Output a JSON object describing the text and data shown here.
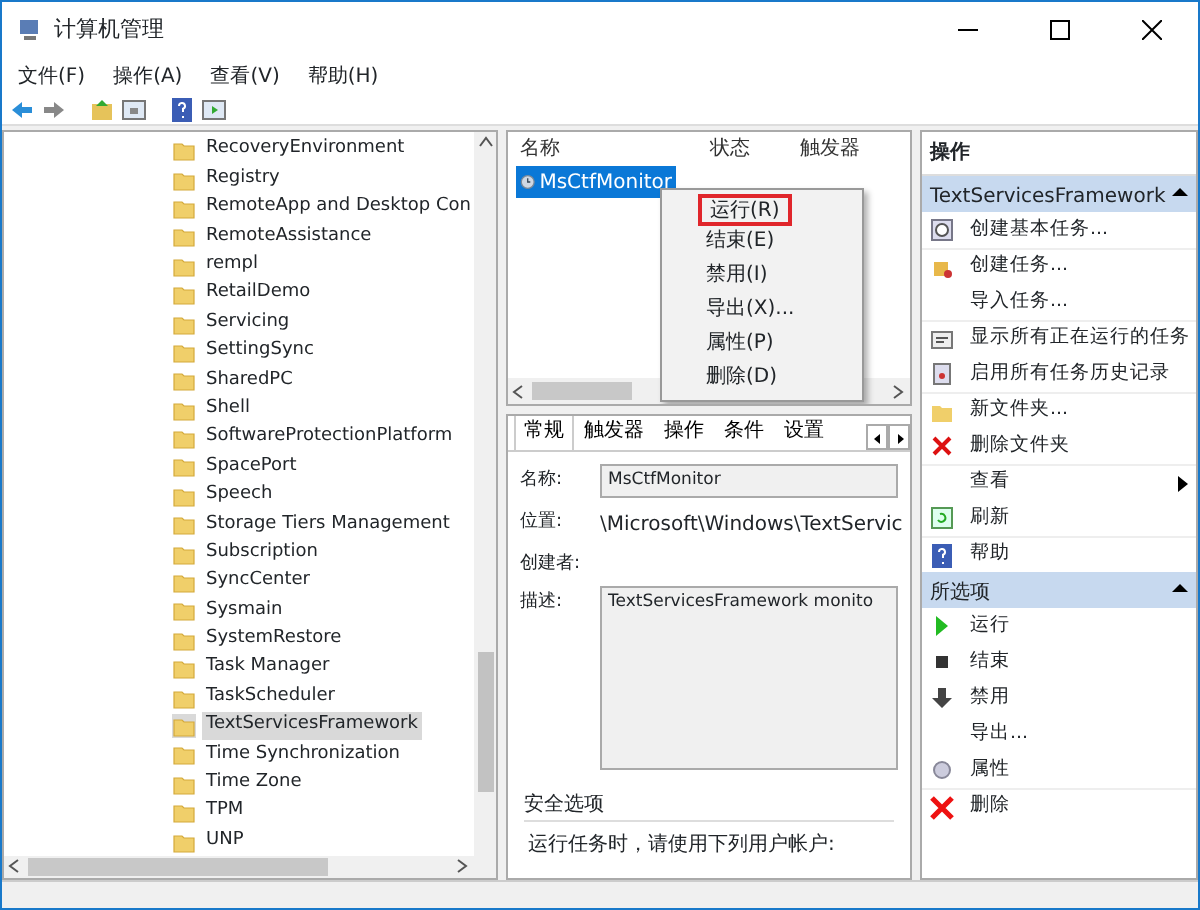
{
  "window": {
    "title": "计算机管理"
  },
  "menu": [
    "文件(F)",
    "操作(A)",
    "查看(V)",
    "帮助(H)"
  ],
  "tree": {
    "items": [
      {
        "label": "RecoveryEnvironment",
        "selected": false
      },
      {
        "label": "Registry",
        "selected": false
      },
      {
        "label": "RemoteApp and Desktop Con",
        "selected": false
      },
      {
        "label": "RemoteAssistance",
        "selected": false
      },
      {
        "label": "rempl",
        "selected": false
      },
      {
        "label": "RetailDemo",
        "selected": false
      },
      {
        "label": "Servicing",
        "selected": false
      },
      {
        "label": "SettingSync",
        "selected": false
      },
      {
        "label": "SharedPC",
        "selected": false
      },
      {
        "label": "Shell",
        "selected": false
      },
      {
        "label": "SoftwareProtectionPlatform",
        "selected": false
      },
      {
        "label": "SpacePort",
        "selected": false
      },
      {
        "label": "Speech",
        "selected": false
      },
      {
        "label": "Storage Tiers Management",
        "selected": false
      },
      {
        "label": "Subscription",
        "selected": false
      },
      {
        "label": "SyncCenter",
        "selected": false
      },
      {
        "label": "Sysmain",
        "selected": false
      },
      {
        "label": "SystemRestore",
        "selected": false
      },
      {
        "label": "Task Manager",
        "selected": false
      },
      {
        "label": "TaskScheduler",
        "selected": false
      },
      {
        "label": "TextServicesFramework",
        "selected": true
      },
      {
        "label": "Time Synchronization",
        "selected": false
      },
      {
        "label": "Time Zone",
        "selected": false
      },
      {
        "label": "TPM",
        "selected": false
      },
      {
        "label": "UNP",
        "selected": false
      }
    ]
  },
  "task_list": {
    "columns": [
      "名称",
      "状态",
      "触发器"
    ],
    "rows": [
      {
        "name": "MsCtfMonitor",
        "selected": true
      }
    ]
  },
  "context_menu": [
    {
      "label": "运行(R)",
      "highlighted": true
    },
    {
      "label": "结束(E)",
      "highlighted": false
    },
    {
      "label": "禁用(I)",
      "highlighted": false
    },
    {
      "label": "导出(X)...",
      "highlighted": false
    },
    {
      "label": "属性(P)",
      "highlighted": false
    },
    {
      "label": "删除(D)",
      "highlighted": false
    }
  ],
  "details": {
    "tabs": [
      {
        "label": "常规",
        "selected": true
      },
      {
        "label": "触发器",
        "selected": false
      },
      {
        "label": "操作",
        "selected": false
      },
      {
        "label": "条件",
        "selected": false
      },
      {
        "label": "设置",
        "selected": false
      }
    ],
    "fields": [
      {
        "label": "名称:",
        "kind": "input",
        "value": "MsCtfMonitor"
      },
      {
        "label": "位置:",
        "kind": "text",
        "value": "\\Microsoft\\Windows\\TextServic"
      },
      {
        "label": "创建者:",
        "kind": "text"
      },
      {
        "label": "描述:",
        "kind": "textarea",
        "value": "TextServicesFramework monito"
      }
    ],
    "security": {
      "title": "安全选项",
      "text": "运行任务时，请使用下列用户帐户:"
    }
  },
  "actions": {
    "title": "操作",
    "sections": [
      {
        "title": "TextServicesFramework",
        "items": [
          {
            "label": "创建基本任务...",
            "kind": "clock"
          },
          {
            "label": "创建任务...",
            "kind": "task"
          },
          {
            "label": "导入任务...",
            "kind": "plain"
          },
          {
            "label": "显示所有正在运行的任务",
            "kind": "list"
          },
          {
            "label": "启用所有任务历史记录",
            "kind": "history"
          },
          {
            "label": "新文件夹...",
            "kind": "folder"
          },
          {
            "label": "删除文件夹",
            "kind": "x"
          },
          {
            "label": "查看",
            "kind": "plain",
            "submenu": true
          },
          {
            "label": "刷新",
            "kind": "refresh"
          },
          {
            "label": "帮助",
            "kind": "help"
          }
        ]
      },
      {
        "title": "所选项",
        "items": [
          {
            "label": "运行",
            "kind": "run"
          },
          {
            "label": "结束",
            "kind": "stop"
          },
          {
            "label": "禁用",
            "kind": "down"
          },
          {
            "label": "导出...",
            "kind": "plain"
          },
          {
            "label": "属性",
            "kind": "props"
          },
          {
            "label": "删除",
            "kind": "bigx"
          }
        ]
      }
    ]
  }
}
